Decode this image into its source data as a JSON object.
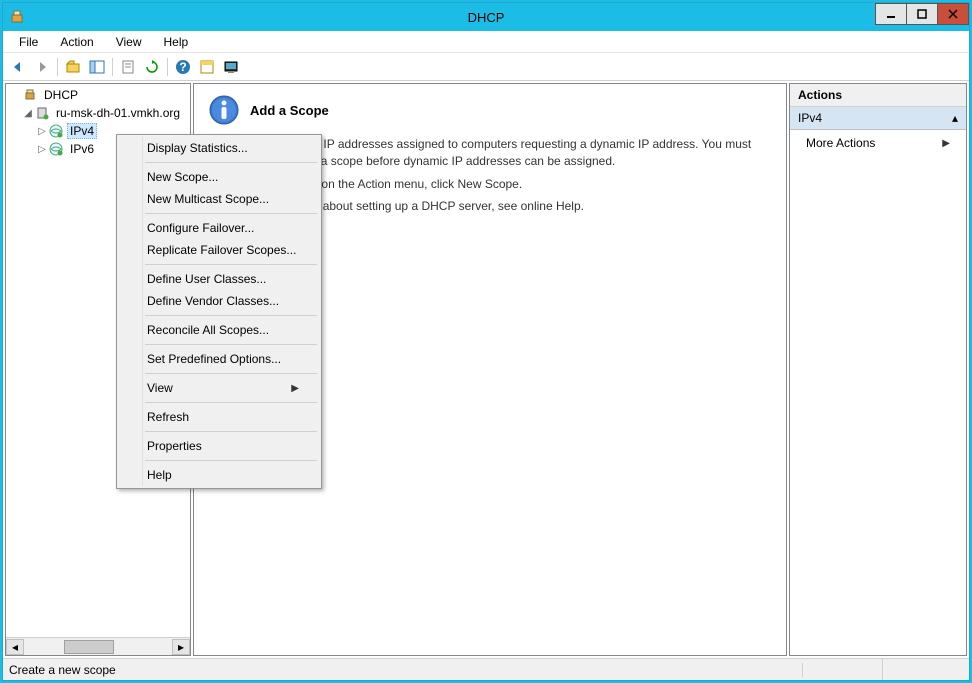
{
  "title": "DHCP",
  "menubar": [
    "File",
    "Action",
    "View",
    "Help"
  ],
  "tree": {
    "root": "DHCP",
    "server": "ru-msk-dh-01.vmkh.org",
    "ipv4": "IPv4",
    "ipv6": "IPv6"
  },
  "center": {
    "title": "Add a Scope",
    "p1": "A scope is a range of IP addresses assigned to computers requesting a dynamic IP address. You must create and configure a scope before dynamic IP addresses can be assigned.",
    "p2": "To add a new scope, on the Action menu, click New Scope.",
    "p3": "For more information about setting up a DHCP server, see online Help."
  },
  "actions": {
    "header": "Actions",
    "section": "IPv4",
    "more": "More Actions"
  },
  "context_menu": [
    {
      "label": "Display Statistics...",
      "t": "i"
    },
    {
      "t": "sep"
    },
    {
      "label": "New Scope...",
      "t": "i"
    },
    {
      "label": "New Multicast Scope...",
      "t": "i"
    },
    {
      "t": "sep"
    },
    {
      "label": "Configure Failover...",
      "t": "i"
    },
    {
      "label": "Replicate Failover Scopes...",
      "t": "i"
    },
    {
      "t": "sep"
    },
    {
      "label": "Define User Classes...",
      "t": "i"
    },
    {
      "label": "Define Vendor Classes...",
      "t": "i"
    },
    {
      "t": "sep"
    },
    {
      "label": "Reconcile All Scopes...",
      "t": "i"
    },
    {
      "t": "sep"
    },
    {
      "label": "Set Predefined Options...",
      "t": "i"
    },
    {
      "t": "sep"
    },
    {
      "label": "View",
      "t": "i",
      "arrow": true
    },
    {
      "t": "sep"
    },
    {
      "label": "Refresh",
      "t": "i"
    },
    {
      "t": "sep"
    },
    {
      "label": "Properties",
      "t": "i"
    },
    {
      "t": "sep"
    },
    {
      "label": "Help",
      "t": "i"
    }
  ],
  "status": "Create a new scope"
}
